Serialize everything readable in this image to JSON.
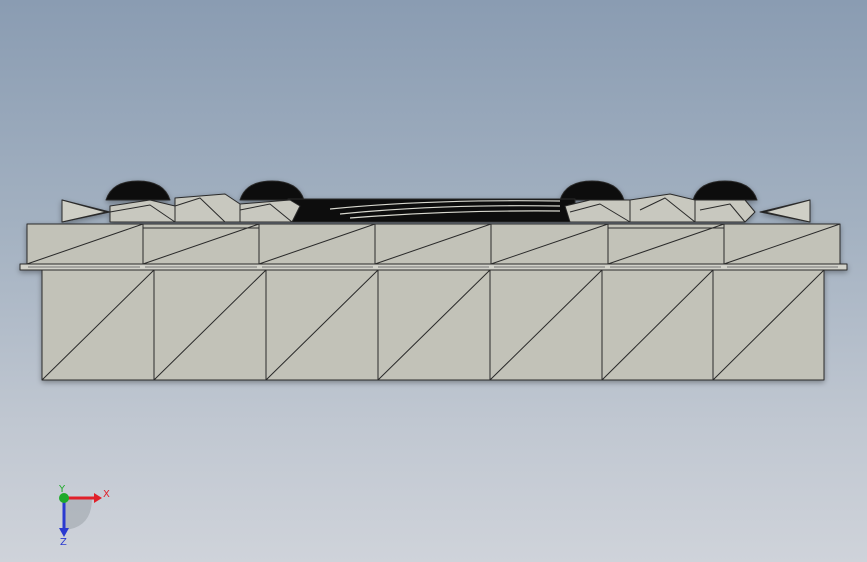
{
  "viewport": {
    "view": "front",
    "model_colors": {
      "face": "#c2c2b8",
      "face_light": "#cfcfc6",
      "edge": "#2a2a2a",
      "dark": "#0a0a0a"
    }
  },
  "triad": {
    "x_label": "X",
    "y_label": "Y",
    "z_label": "Z",
    "x_color": "#e0202a",
    "y_color": "#1faa2a",
    "z_color": "#2a3ad0"
  }
}
